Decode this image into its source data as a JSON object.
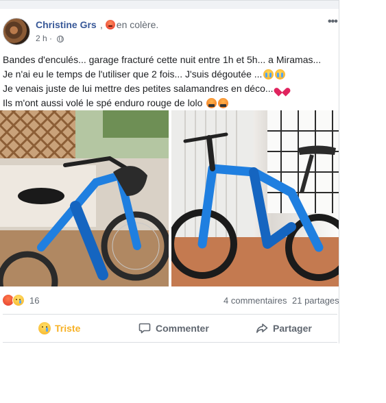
{
  "post": {
    "author": "Christine Grs",
    "feeling": "en colère.",
    "time": "2 h",
    "text_lines": [
      "Bandes d'enculés... garage fracturé cette nuit entre 1h et 5h... a Miramas...",
      "Je n'ai eu le temps de l'utiliser que 2 fois... J'suis dégoutée ...",
      "Je venais juste de lui mettre des petites salamandres en déco...",
      "Ils m'ont aussi volé le spé enduro rouge de lolo"
    ],
    "emojis": {
      "line2": [
        "crying-face-icon",
        "crying-face-icon"
      ],
      "line3": [
        "broken-heart-icon"
      ],
      "line4": [
        "swearing-face-icon",
        "swearing-face-icon"
      ]
    }
  },
  "reactions": {
    "icons": [
      "angry-reaction-icon",
      "sad-reaction-icon"
    ],
    "count": "16",
    "comments": "4 commentaires",
    "shares": "21 partages"
  },
  "actions": {
    "sad": "Triste",
    "comment": "Commenter",
    "share": "Partager"
  },
  "colors": {
    "author": "#385898",
    "sad_active": "#f7b125",
    "bike_blue": "#1f7fe0"
  }
}
